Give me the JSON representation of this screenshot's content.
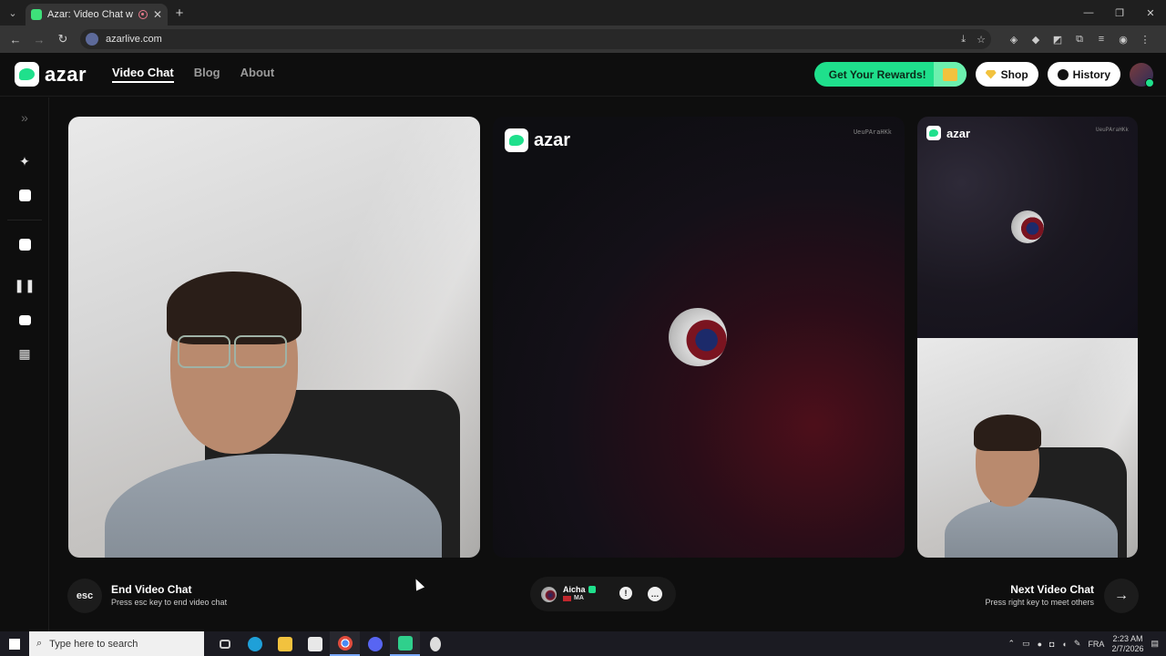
{
  "browser": {
    "tab_title": "Azar: Video Chat with New",
    "url": "azarlive.com",
    "new_tab": "+",
    "tab_close": "✕"
  },
  "header": {
    "logo": "azar",
    "nav": [
      "Video Chat",
      "Blog",
      "About"
    ],
    "rewards_label": "Get Your Rewards!",
    "shop_label": "Shop",
    "history_label": "History"
  },
  "remote_panel": {
    "logo": "azar",
    "user_id": "UeuPAraHKk"
  },
  "side_panel": {
    "logo": "azar",
    "user_id": "UeuPAraHKk"
  },
  "footer": {
    "esc_label": "esc",
    "end_title": "End Video Chat",
    "end_sub": "Press esc key to end video chat",
    "match_name": "Aicha",
    "match_country": "MA",
    "next_title": "Next Video Chat",
    "next_sub": "Press right key to meet others"
  },
  "taskbar": {
    "search_placeholder": "Type here to search",
    "language": "FRA",
    "time": "2:23 AM",
    "date": "2/7/2026"
  },
  "colors": {
    "brand_green": "#1fe08c",
    "background": "#0e0e0e"
  }
}
